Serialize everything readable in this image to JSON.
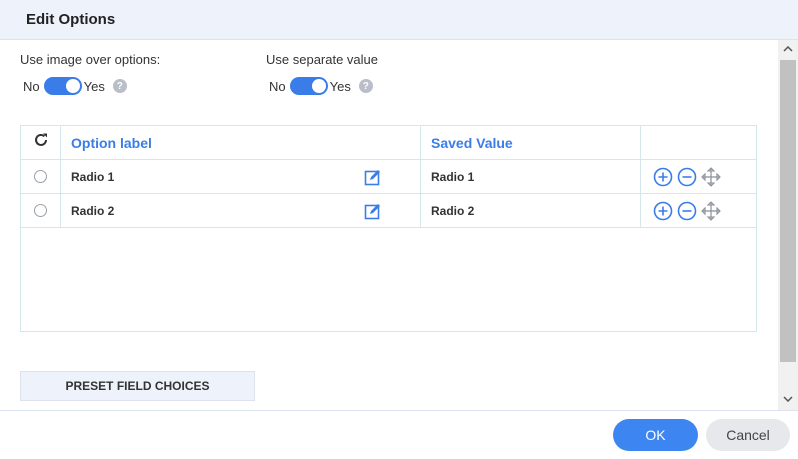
{
  "dialog": {
    "title": "Edit Options"
  },
  "options": {
    "image_over_options": {
      "label": "Use image over options:",
      "off_label": "No",
      "on_label": "Yes",
      "value": "on",
      "help": "?"
    },
    "separate_value": {
      "label": "Use separate value",
      "off_label": "No",
      "on_label": "Yes",
      "value": "on",
      "help": "?"
    }
  },
  "table": {
    "reset_icon": "refresh-icon",
    "headers": [
      "Option label",
      "Saved Value"
    ],
    "rows": [
      {
        "label": "Radio 1",
        "value": "Radio 1"
      },
      {
        "label": "Radio 2",
        "value": "Radio 2"
      }
    ],
    "row_icons": [
      "edit-icon",
      "add-circle-icon",
      "remove-circle-icon",
      "move-icon"
    ]
  },
  "preset_button": "PRESET FIELD CHOICES",
  "footer": {
    "ok": "OK",
    "cancel": "Cancel"
  },
  "colors": {
    "accent": "#3a7de8",
    "header_bg": "#eef2fa",
    "border": "#d5e6ec"
  }
}
